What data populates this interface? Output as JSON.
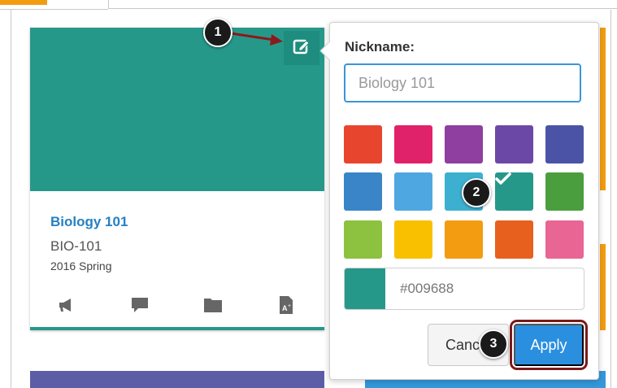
{
  "course_card": {
    "title": "Biology 101",
    "code": "BIO-101",
    "term": "2016 Spring",
    "color": "#26988a",
    "actions": [
      "announcements-icon",
      "discussions-icon",
      "files-icon",
      "grades-icon"
    ]
  },
  "nickname_popover": {
    "label": "Nickname:",
    "input_placeholder": "Biology 101",
    "swatches": [
      {
        "color": "#e8452f"
      },
      {
        "color": "#e0226a"
      },
      {
        "color": "#8e3fa0"
      },
      {
        "color": "#6c48a6"
      },
      {
        "color": "#4b53a6"
      },
      {
        "color": "#3a85c8"
      },
      {
        "color": "#4fa7e2"
      },
      {
        "color": "#3db0d0"
      },
      {
        "color": "#26988a",
        "selected": true
      },
      {
        "color": "#4a9e3e"
      },
      {
        "color": "#8cc23f"
      },
      {
        "color": "#f9c000"
      },
      {
        "color": "#f39c12"
      },
      {
        "color": "#e8601e"
      },
      {
        "color": "#e96594"
      }
    ],
    "hex_value": "#009688",
    "cancel_label": "Cancel",
    "apply_label": "Apply"
  },
  "steps": [
    "1",
    "2",
    "3"
  ]
}
